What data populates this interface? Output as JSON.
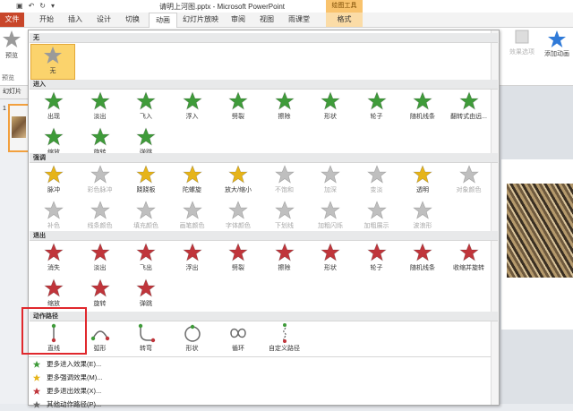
{
  "window": {
    "title": "请明上河图.pptx - Microsoft PowerPoint",
    "context_group": "绘图工具"
  },
  "tabs": {
    "file": "文件",
    "home": "开始",
    "insert": "插入",
    "design": "设计",
    "transitions": "切换",
    "animations": "动画",
    "slideshow": "幻灯片放映",
    "review": "审阅",
    "view": "视图",
    "classroom": "雨课堂",
    "format": "格式"
  },
  "ribbon": {
    "preview": "预览",
    "preview_group": "预览",
    "effect_options": "效果选项",
    "add_animation": "添加动画",
    "slides_tab": "幻灯片"
  },
  "slide_panel": {
    "slide_number": "1"
  },
  "gallery": {
    "sections": {
      "none": "无",
      "entrance": "进入",
      "emphasis": "强调",
      "exit": "退出",
      "motion": "动作路径"
    },
    "none_items": [
      "无"
    ],
    "entrance_items": [
      "出现",
      "淡出",
      "飞入",
      "浮入",
      "劈裂",
      "擦除",
      "形状",
      "轮子",
      "随机线条",
      "翻转式由远...",
      "缩放",
      "旋转",
      "弹跳"
    ],
    "emphasis_items": [
      "脉冲",
      "彩色脉冲",
      "跷跷板",
      "陀螺旋",
      "放大/缩小",
      "不饱和",
      "加深",
      "变淡",
      "透明",
      "对象颜色",
      "补色",
      "线条颜色",
      "填充颜色",
      "画笔颜色",
      "字体颜色",
      "下划线",
      "加粗闪烁",
      "加粗展示",
      "波浪形"
    ],
    "exit_items": [
      "消失",
      "淡出",
      "飞出",
      "浮出",
      "劈裂",
      "擦除",
      "形状",
      "轮子",
      "随机线条",
      "收缩并旋转",
      "缩放",
      "旋转",
      "弹跳"
    ],
    "motion_items": [
      "直线",
      "弧形",
      "转弯",
      "形状",
      "循环",
      "自定义路径"
    ],
    "links": [
      "更多进入效果(E)...",
      "更多强调效果(M)...",
      "更多退出效果(X)...",
      "其他动作路径(P)..."
    ]
  },
  "colors": {
    "entrance": "#3f9b3a",
    "emphasis": "#e6b419",
    "exit": "#c0353b",
    "disabled": "#bfbfbf",
    "highlight": "#e0282d",
    "selected": "#fbd36c",
    "file_tab": "#c8462a"
  }
}
